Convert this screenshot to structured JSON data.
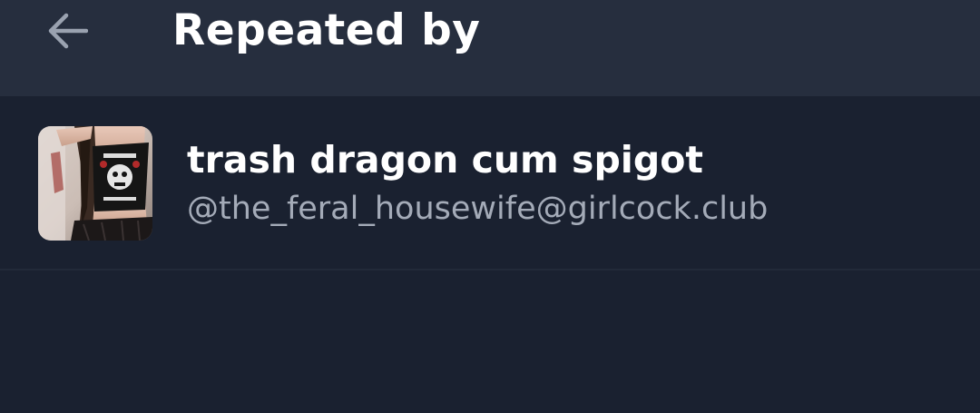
{
  "header": {
    "title": "Repeated by",
    "back_icon": "arrow-left-icon"
  },
  "accounts": [
    {
      "display_name": "trash dragon cum spigot",
      "handle": "@the_feral_housewife@girlcock.club",
      "avatar": "user-avatar-photo"
    }
  ],
  "colors": {
    "header_bg": "#262e3e",
    "body_bg": "#1a2130",
    "name_text": "#ffffff",
    "handle_text": "#a4abb8"
  }
}
